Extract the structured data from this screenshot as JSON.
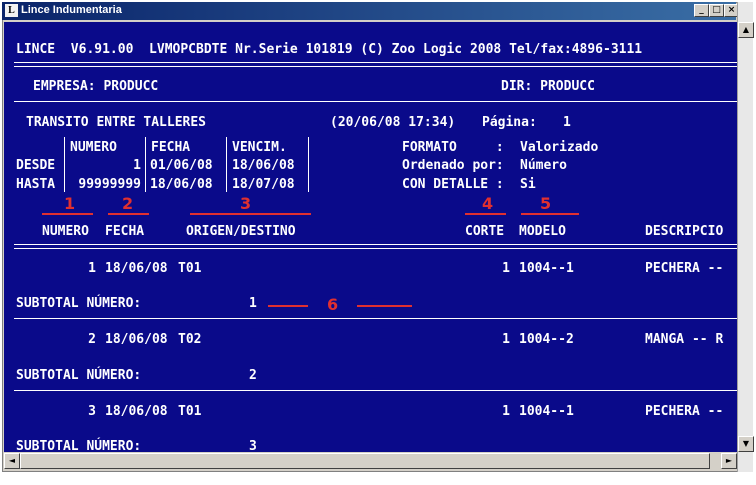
{
  "window": {
    "title": "Lince Indumentaria",
    "minimize": "_",
    "maximize": "□",
    "close": "×"
  },
  "header": {
    "banner": "LINCE  V6.91.00  LVMOPCBDTE Nr.Serie 101819 (C) Zoo Logic 2008 Tel/fax:4896-3111",
    "empresa": "EMPRESA: PRODUCC",
    "dir": "DIR: PRODUCC"
  },
  "report": {
    "title": "TRANSITO ENTRE TALLERES",
    "datetime": "(20/06/08 17:34)",
    "page_label": "Página:",
    "page_number": "1",
    "filter_headers": {
      "numero": "NUMERO",
      "fecha": "FECHA",
      "vencim": "VENCIM."
    },
    "desde": {
      "label": "DESDE",
      "numero": "1",
      "fecha": "01/06/08",
      "vencim": "18/06/08"
    },
    "hasta": {
      "label": "HASTA",
      "numero": "99999999",
      "fecha": "18/06/08",
      "vencim": "18/07/08"
    },
    "options": [
      {
        "label": "FORMATO     :",
        "value": "Valorizado"
      },
      {
        "label": "Ordenado por:",
        "value": "Número"
      },
      {
        "label": "CON DETALLE :",
        "value": "Si"
      }
    ]
  },
  "annotations": [
    "1",
    "2",
    "3",
    "4",
    "5",
    "6"
  ],
  "columns": {
    "numero": "NUMERO",
    "fecha": "FECHA",
    "origen": "ORIGEN/DESTINO",
    "corte": "CORTE",
    "modelo": "MODELO",
    "descripcion": "DESCRIPCIO"
  },
  "rows": [
    {
      "numero": "1",
      "fecha": "18/06/08",
      "origen": "T01",
      "corte": "1",
      "modelo": "1004--1",
      "descripcion": "PECHERA --",
      "subtotal_label": "SUBTOTAL NÚMERO:",
      "subtotal_value": "1"
    },
    {
      "numero": "2",
      "fecha": "18/06/08",
      "origen": "T02",
      "corte": "1",
      "modelo": "1004--2",
      "descripcion": "MANGA -- R",
      "subtotal_label": "SUBTOTAL NÚMERO:",
      "subtotal_value": "2"
    },
    {
      "numero": "3",
      "fecha": "18/06/08",
      "origen": "T01",
      "corte": "1",
      "modelo": "1004--1",
      "descripcion": "PECHERA --",
      "subtotal_label": "SUBTOTAL NÚMERO:",
      "subtotal_value": "3"
    }
  ],
  "icons": {
    "scroll_left": "◄",
    "scroll_right": "►",
    "scroll_up": "▲",
    "scroll_down": "▼"
  }
}
